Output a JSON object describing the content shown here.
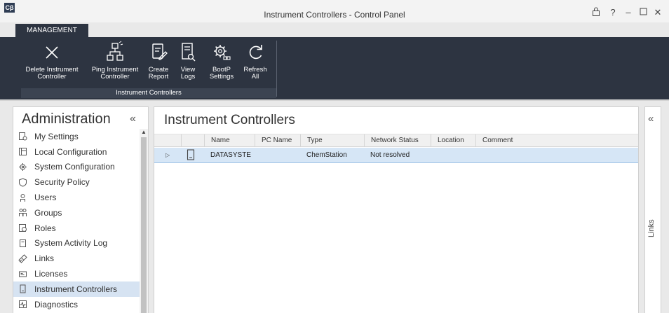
{
  "window": {
    "app_icon_text": "Cβ",
    "title": "Instrument Controllers - Control Panel",
    "controls": [
      "lock-icon",
      "help-icon",
      "minimize-icon",
      "maximize-icon",
      "close-icon"
    ]
  },
  "ribbon": {
    "tab": "MANAGEMENT",
    "buttons": [
      {
        "label": "Delete Instrument\nController",
        "icon": "delete-x-icon"
      },
      {
        "label": "Ping Instrument\nController",
        "icon": "network-icon"
      },
      {
        "label": "Create\nReport",
        "icon": "report-edit-icon"
      },
      {
        "label": "View\nLogs",
        "icon": "logs-search-icon"
      },
      {
        "label": "BootP\nSettings",
        "icon": "gear-settings-icon"
      },
      {
        "label": "Refresh\nAll",
        "icon": "refresh-icon"
      }
    ],
    "group_label": "Instrument Controllers"
  },
  "sidebar": {
    "title": "Administration",
    "collapse_glyph": "«",
    "items": [
      {
        "label": "My Settings",
        "icon": "my-settings-icon"
      },
      {
        "label": "Local Configuration",
        "icon": "local-config-icon"
      },
      {
        "label": "System Configuration",
        "icon": "system-config-icon"
      },
      {
        "label": "Security Policy",
        "icon": "shield-icon"
      },
      {
        "label": "Users",
        "icon": "user-icon"
      },
      {
        "label": "Groups",
        "icon": "groups-icon"
      },
      {
        "label": "Roles",
        "icon": "roles-icon"
      },
      {
        "label": "System Activity Log",
        "icon": "activity-log-icon"
      },
      {
        "label": "Links",
        "icon": "link-icon"
      },
      {
        "label": "Licenses",
        "icon": "license-icon"
      },
      {
        "label": "Instrument Controllers",
        "icon": "instrument-controller-icon",
        "selected": true
      },
      {
        "label": "Diagnostics",
        "icon": "diagnostics-icon"
      }
    ]
  },
  "main": {
    "title": "Instrument Controllers",
    "columns": [
      "Name",
      "PC Name",
      "Type",
      "Network Status",
      "Location",
      "Comment"
    ],
    "rows": [
      {
        "name": "DATASYSTE",
        "pc_name": "",
        "type": "ChemStation",
        "network_status": "Not resolved",
        "location": "",
        "comment": ""
      }
    ]
  },
  "links_panel": {
    "label": "Links",
    "collapse_glyph": "«"
  },
  "colors": {
    "ribbon_bg": "#2d3441",
    "selection": "#d6e3f2",
    "row_selection": "#d6e6f6"
  }
}
